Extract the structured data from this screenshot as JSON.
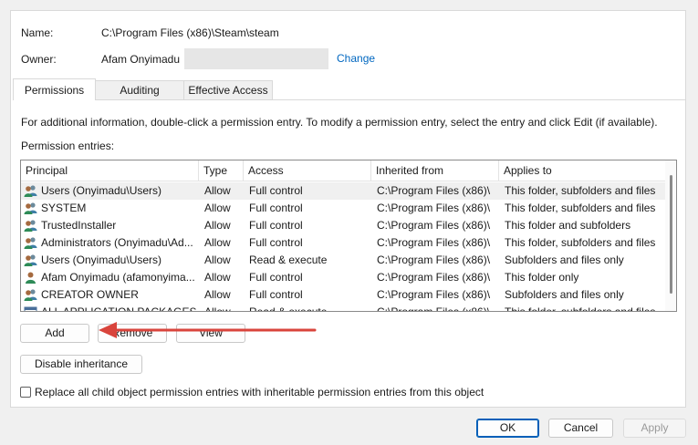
{
  "colors": {
    "accent": "#0067c0",
    "arrow": "#d9443c"
  },
  "name_label": "Name:",
  "name_value": "C:\\Program Files (x86)\\Steam\\steam",
  "owner_label": "Owner:",
  "owner_value": "Afam Onyimadu",
  "change_link": "Change",
  "tabs": [
    {
      "label": "Permissions",
      "active": true
    },
    {
      "label": "Auditing",
      "active": false
    },
    {
      "label": "Effective Access",
      "active": false
    }
  ],
  "info_text": "For additional information, double-click a permission entry. To modify a permission entry, select the entry and click Edit (if available).",
  "entries_label": "Permission entries:",
  "columns": [
    "Principal",
    "Type",
    "Access",
    "Inherited from",
    "Applies to"
  ],
  "rows": [
    {
      "icon": "users-group-icon",
      "principal": "Users (Onyimadu\\Users)",
      "type": "Allow",
      "access": "Full control",
      "inherited": "C:\\Program Files (x86)\\",
      "applies": "This folder, subfolders and files"
    },
    {
      "icon": "users-group-icon",
      "principal": "SYSTEM",
      "type": "Allow",
      "access": "Full control",
      "inherited": "C:\\Program Files (x86)\\",
      "applies": "This folder, subfolders and files"
    },
    {
      "icon": "users-group-icon",
      "principal": "TrustedInstaller",
      "type": "Allow",
      "access": "Full control",
      "inherited": "C:\\Program Files (x86)\\",
      "applies": "This folder and subfolders"
    },
    {
      "icon": "users-group-icon",
      "principal": "Administrators (Onyimadu\\Ad...",
      "type": "Allow",
      "access": "Full control",
      "inherited": "C:\\Program Files (x86)\\",
      "applies": "This folder, subfolders and files"
    },
    {
      "icon": "users-group-icon",
      "principal": "Users (Onyimadu\\Users)",
      "type": "Allow",
      "access": "Read & execute",
      "inherited": "C:\\Program Files (x86)\\",
      "applies": "Subfolders and files only"
    },
    {
      "icon": "user-icon",
      "principal": "Afam Onyimadu (afamonyima...",
      "type": "Allow",
      "access": "Full control",
      "inherited": "C:\\Program Files (x86)\\",
      "applies": "This folder only"
    },
    {
      "icon": "users-group-icon",
      "principal": "CREATOR OWNER",
      "type": "Allow",
      "access": "Full control",
      "inherited": "C:\\Program Files (x86)\\",
      "applies": "Subfolders and files only"
    },
    {
      "icon": "app-package-icon",
      "principal": "ALL APPLICATION PACKAGES",
      "type": "Allow",
      "access": "Read & execute",
      "inherited": "C:\\Program Files (x86)\\",
      "applies": "This folder, subfolders and files"
    }
  ],
  "buttons": {
    "add": "Add",
    "remove": "Remove",
    "view": "View",
    "disable_inheritance": "Disable inheritance",
    "ok": "OK",
    "cancel": "Cancel",
    "apply": "Apply"
  },
  "replace_checkbox_label": "Replace all child object permission entries with inheritable permission entries from this object"
}
